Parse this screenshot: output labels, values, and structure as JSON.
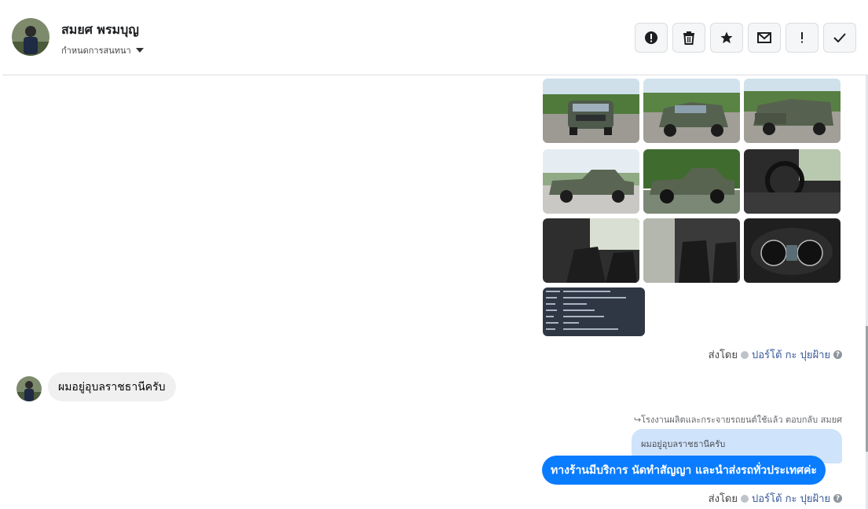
{
  "header": {
    "name": "สมยศ พรมบุญ",
    "convo_label": "กำหนดการสนทนา",
    "tools": [
      {
        "name": "report-icon",
        "glyph": "!"
      },
      {
        "name": "trash-icon",
        "glyph": "🗑"
      },
      {
        "name": "star-icon",
        "glyph": "★"
      },
      {
        "name": "mail-icon",
        "glyph": "✉"
      },
      {
        "name": "important-icon",
        "glyph": "!"
      },
      {
        "name": "check-icon",
        "glyph": "✓"
      }
    ]
  },
  "gallery": {
    "photos": [
      {
        "kind": "front"
      },
      {
        "kind": "front-3q"
      },
      {
        "kind": "rear-3q"
      },
      {
        "kind": "side-sky"
      },
      {
        "kind": "side-grass"
      },
      {
        "kind": "dash"
      },
      {
        "kind": "seat"
      },
      {
        "kind": "rear-seat"
      },
      {
        "kind": "gauge"
      },
      {
        "kind": "doc"
      }
    ]
  },
  "sent_meta": {
    "prefix": "ส่งโดย",
    "sender": "ปอร์โต้ กะ ปุยฝ้าย"
  },
  "incoming": {
    "text": "ผมอยู่อุบลราชธานีครับ"
  },
  "reply_note": "โรงงานผลิตและกระจายรถยนต์ใช้แล้ว ตอบกลับ สมยศ",
  "quoted": {
    "text": "ผมอยู่อุบลราชธานีครับ"
  },
  "outgoing": {
    "text": "ทางร้านมีบริการ นัดทำสัญญา และนำส่งรถทั่วประเทศค่ะ"
  },
  "sent_meta2": {
    "prefix": "ส่งโดย",
    "sender": "ปอร์โต้ กะ ปุยฝ้าย"
  },
  "colors": {
    "accent": "#0a7cff",
    "link": "#385898"
  }
}
